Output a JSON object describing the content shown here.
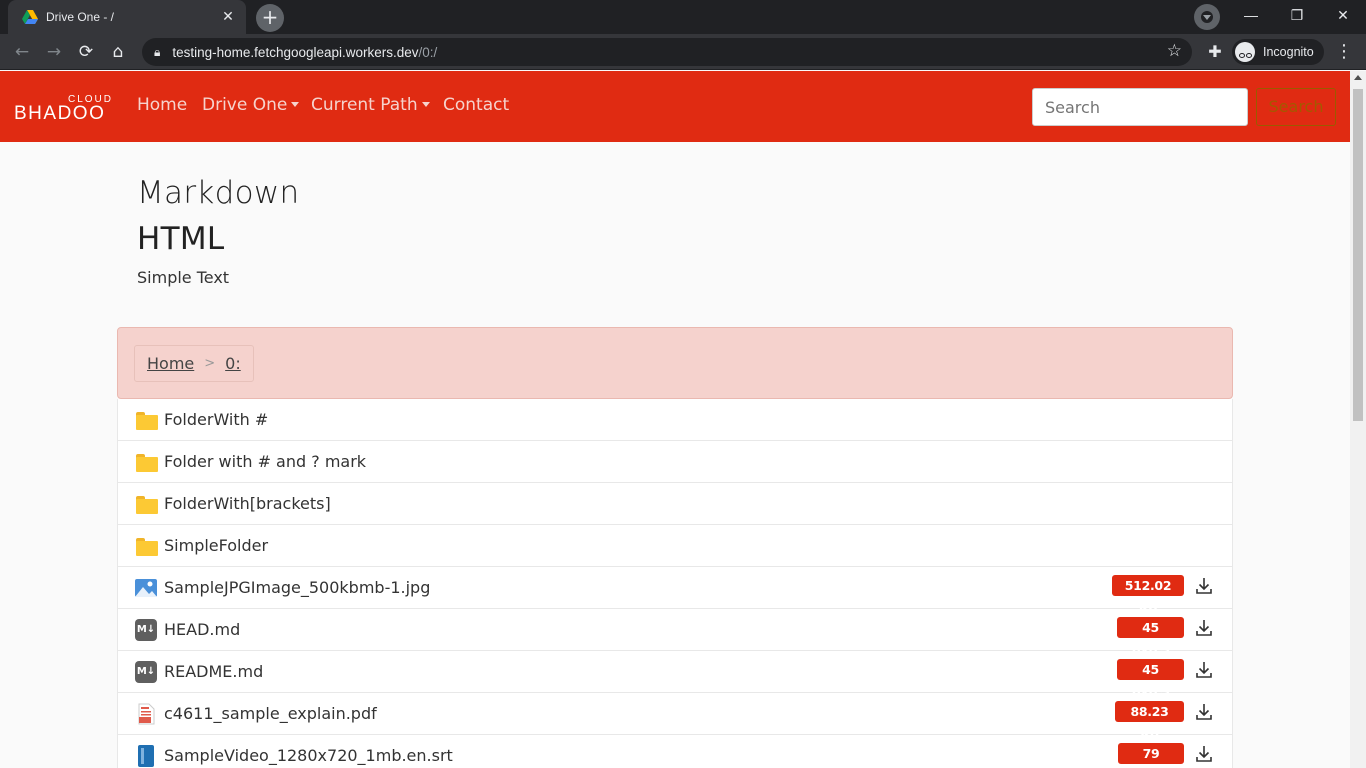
{
  "browser": {
    "tab_title": "Drive One - /",
    "tab_close": "✕",
    "new_tab": "+",
    "url_host": "testing-home.fetchgoogleapi.workers.dev",
    "url_path": "/0:/",
    "incognito_label": "Incognito",
    "window_min": "—",
    "window_restore": "❐",
    "window_close": "✕"
  },
  "navbar": {
    "brand_top": "CLOUD",
    "brand_main": "BHADOO",
    "links": [
      "Home",
      "Drive One",
      "Current Path",
      "Contact"
    ],
    "search_placeholder": "Search",
    "search_button": "Search",
    "color": "#e02b12"
  },
  "readme": {
    "h1": "Markdown",
    "h2": "HTML",
    "text": "Simple Text"
  },
  "breadcrumb": {
    "home": "Home",
    "separator": ">",
    "current": "0:"
  },
  "files": [
    {
      "name": "FolderWith #",
      "type": "folder",
      "icon": "folder-icon"
    },
    {
      "name": "Folder with # and ? mark",
      "type": "folder",
      "icon": "folder-icon"
    },
    {
      "name": "FolderWith[brackets]",
      "type": "folder",
      "icon": "folder-icon"
    },
    {
      "name": "SimpleFolder",
      "type": "folder",
      "icon": "folder-icon"
    },
    {
      "name": "SampleJPGImage_500kbmb-1.jpg",
      "type": "image",
      "icon": "image-file-icon",
      "size": "512.02 KB"
    },
    {
      "name": "HEAD.md",
      "type": "markdown",
      "icon": "markdown-file-icon",
      "size": "45 bytes"
    },
    {
      "name": "README.md",
      "type": "markdown",
      "icon": "markdown-file-icon",
      "size": "45 bytes"
    },
    {
      "name": "c4611_sample_explain.pdf",
      "type": "pdf",
      "icon": "pdf-file-icon",
      "size": "88.23 KB"
    },
    {
      "name": "SampleVideo_1280x720_1mb.en.srt",
      "type": "subtitle",
      "icon": "subtitle-file-icon",
      "size": "79 bytes"
    }
  ]
}
